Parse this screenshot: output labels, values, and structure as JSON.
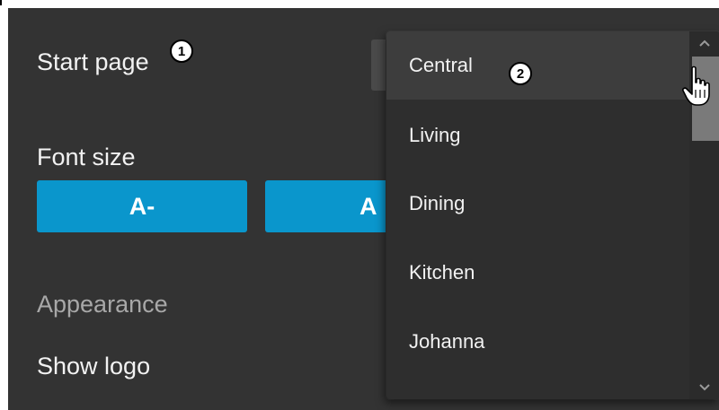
{
  "settings": {
    "start_page_label": "Start page",
    "font_size_label": "Font size",
    "decrease_font_label": "A-",
    "increase_font_label": "A",
    "appearance_heading": "Appearance",
    "show_logo_label": "Show logo"
  },
  "callouts": {
    "first": "1",
    "second": "2"
  },
  "start_page_dropdown": {
    "selected": "Central",
    "options": [
      "Central",
      "Living",
      "Dining",
      "Kitchen",
      "Johanna"
    ],
    "scroll_position": 0
  },
  "icons": {
    "scroll_up": "chevron-up-icon",
    "scroll_down": "chevron-down-icon",
    "cursor": "hand-pointer-icon"
  },
  "colors": {
    "background": "#333333",
    "accent": "#0a96cc",
    "dropdown_bg": "#2e2e2e",
    "selected_item_bg": "#3d3d3d",
    "text": "#f2f2f2",
    "muted_text": "#a8a8a8"
  }
}
